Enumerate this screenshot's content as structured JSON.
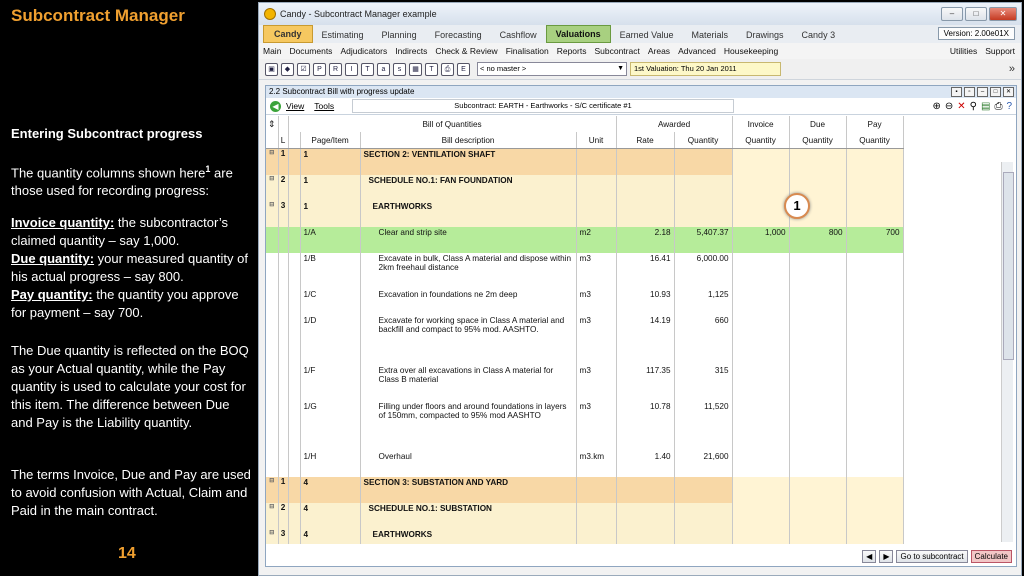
{
  "slide": {
    "title": "Subcontract Manager",
    "heading": "Entering Subcontract progress",
    "intro_a": "The quantity columns shown here",
    "intro_sup": "1",
    "intro_b": " are those used for recording progress:",
    "inv_term": "Invoice quantity:",
    "inv_text": " the subcontractor’s claimed quantity – say 1,000.",
    "due_term": "Due quantity:",
    "due_text": " your measured quantity of his actual progress – say 800.",
    "pay_term": "Pay quantity:",
    "pay_text": " the quantity you approve for payment – say 700.",
    "para2": "The Due quantity is  reflected on the BOQ as your Actual quantity, while the Pay quantity is used to calculate your cost for this item.  The difference between Due and Pay is the Liability quantity.",
    "para3": "The terms Invoice, Due and Pay are used to avoid confusion with Actual, Claim and Paid in the main contract.",
    "page_number": "14"
  },
  "window": {
    "title": "Candy - Subcontract Manager example",
    "version": "Version: 2.00e01X",
    "tabs": [
      "Candy",
      "Estimating",
      "Planning",
      "Forecasting",
      "Cashflow",
      "Valuations",
      "Earned Value",
      "Materials",
      "Drawings",
      "Candy 3"
    ],
    "menu": [
      "Main",
      "Documents",
      "Adjudicators",
      "Indirects",
      "Check & Review",
      "Finalisation",
      "Reports",
      "Subcontract",
      "Areas",
      "Advanced",
      "Housekeeping"
    ],
    "menu_right": [
      "Utilities",
      "Support"
    ],
    "master_combo": "< no master >",
    "valuation": "1st Valuation: Thu 20 Jan 2011"
  },
  "inner": {
    "title": "2.2 Subcontract Bill with progress update",
    "view": "View",
    "tools": "Tools",
    "subtitle": "Subcontract: EARTH - Earthworks - S/C certificate #1",
    "callout": "1",
    "goto": "Go to subcontract",
    "calculate": "Calculate"
  },
  "grid": {
    "group_boq": "Bill of Quantities",
    "group_awarded": "Awarded",
    "col_l": "L",
    "col_page": "Page/Item",
    "col_desc": "Bill description",
    "col_unit": "Unit",
    "col_rate": "Rate",
    "col_qty": "Quantity",
    "col_inv_a": "Invoice",
    "col_inv_b": "Quantity",
    "col_due_a": "Due",
    "col_due_b": "Quantity",
    "col_pay_a": "Pay",
    "col_pay_b": "Quantity",
    "rows": [
      {
        "kind": "sec",
        "l": "1",
        "page": "1",
        "desc": "SECTION 2: VENTILATION SHAFT",
        "unit": "",
        "rate": "",
        "qty": "",
        "inv": "",
        "due": "",
        "pay": ""
      },
      {
        "kind": "sch",
        "l": "2",
        "page": "1",
        "desc": "SCHEDULE NO.1: FAN FOUNDATION",
        "unit": "",
        "rate": "",
        "qty": "",
        "inv": "",
        "due": "",
        "pay": ""
      },
      {
        "kind": "ear",
        "l": "3",
        "page": "1",
        "desc": "EARTHWORKS",
        "unit": "",
        "rate": "",
        "qty": "",
        "inv": "",
        "due": "",
        "pay": ""
      },
      {
        "kind": "sel",
        "l": "",
        "page": "1/A",
        "desc": "Clear and strip site",
        "unit": "m2",
        "rate": "2.18",
        "qty": "5,407.37",
        "inv": "1,000",
        "due": "800",
        "pay": "700"
      },
      {
        "kind": "item",
        "l": "",
        "page": "1/B",
        "desc": "Excavate in bulk, Class A material and dispose within 2km freehaul distance",
        "unit": "m3",
        "rate": "16.41",
        "qty": "6,000.00",
        "inv": "",
        "due": "",
        "pay": ""
      },
      {
        "kind": "item",
        "l": "",
        "page": "1/C",
        "desc": "Excavation in foundations ne 2m deep",
        "unit": "m3",
        "rate": "10.93",
        "qty": "1,125",
        "inv": "",
        "due": "",
        "pay": ""
      },
      {
        "kind": "item",
        "l": "",
        "page": "1/D",
        "desc": "Excavate for working space in Class A material and backfill and compact to 95% mod. AASHTO.",
        "unit": "m3",
        "rate": "14.19",
        "qty": "660",
        "inv": "",
        "due": "",
        "pay": ""
      },
      {
        "kind": "item",
        "l": "",
        "page": "1/F",
        "desc": "Extra over all excavations in Class A material for Class B material",
        "unit": "m3",
        "rate": "117.35",
        "qty": "315",
        "inv": "",
        "due": "",
        "pay": ""
      },
      {
        "kind": "item",
        "l": "",
        "page": "1/G",
        "desc": "Filling under floors and around foundations in layers of 150mm, compacted to 95% mod AASHTO",
        "unit": "m3",
        "rate": "10.78",
        "qty": "11,520",
        "inv": "",
        "due": "",
        "pay": ""
      },
      {
        "kind": "item",
        "l": "",
        "page": "1/H",
        "desc": "Overhaul",
        "unit": "m3.km",
        "rate": "1.40",
        "qty": "21,600",
        "inv": "",
        "due": "",
        "pay": ""
      },
      {
        "kind": "sec",
        "l": "1",
        "page": "4",
        "desc": "SECTION 3: SUBSTATION AND YARD",
        "unit": "",
        "rate": "",
        "qty": "",
        "inv": "",
        "due": "",
        "pay": ""
      },
      {
        "kind": "sch",
        "l": "2",
        "page": "4",
        "desc": "SCHEDULE NO.1: SUBSTATION",
        "unit": "",
        "rate": "",
        "qty": "",
        "inv": "",
        "due": "",
        "pay": ""
      },
      {
        "kind": "ear",
        "l": "3",
        "page": "4",
        "desc": "EARTHWORKS",
        "unit": "",
        "rate": "",
        "qty": "",
        "inv": "",
        "due": "",
        "pay": ""
      }
    ]
  }
}
